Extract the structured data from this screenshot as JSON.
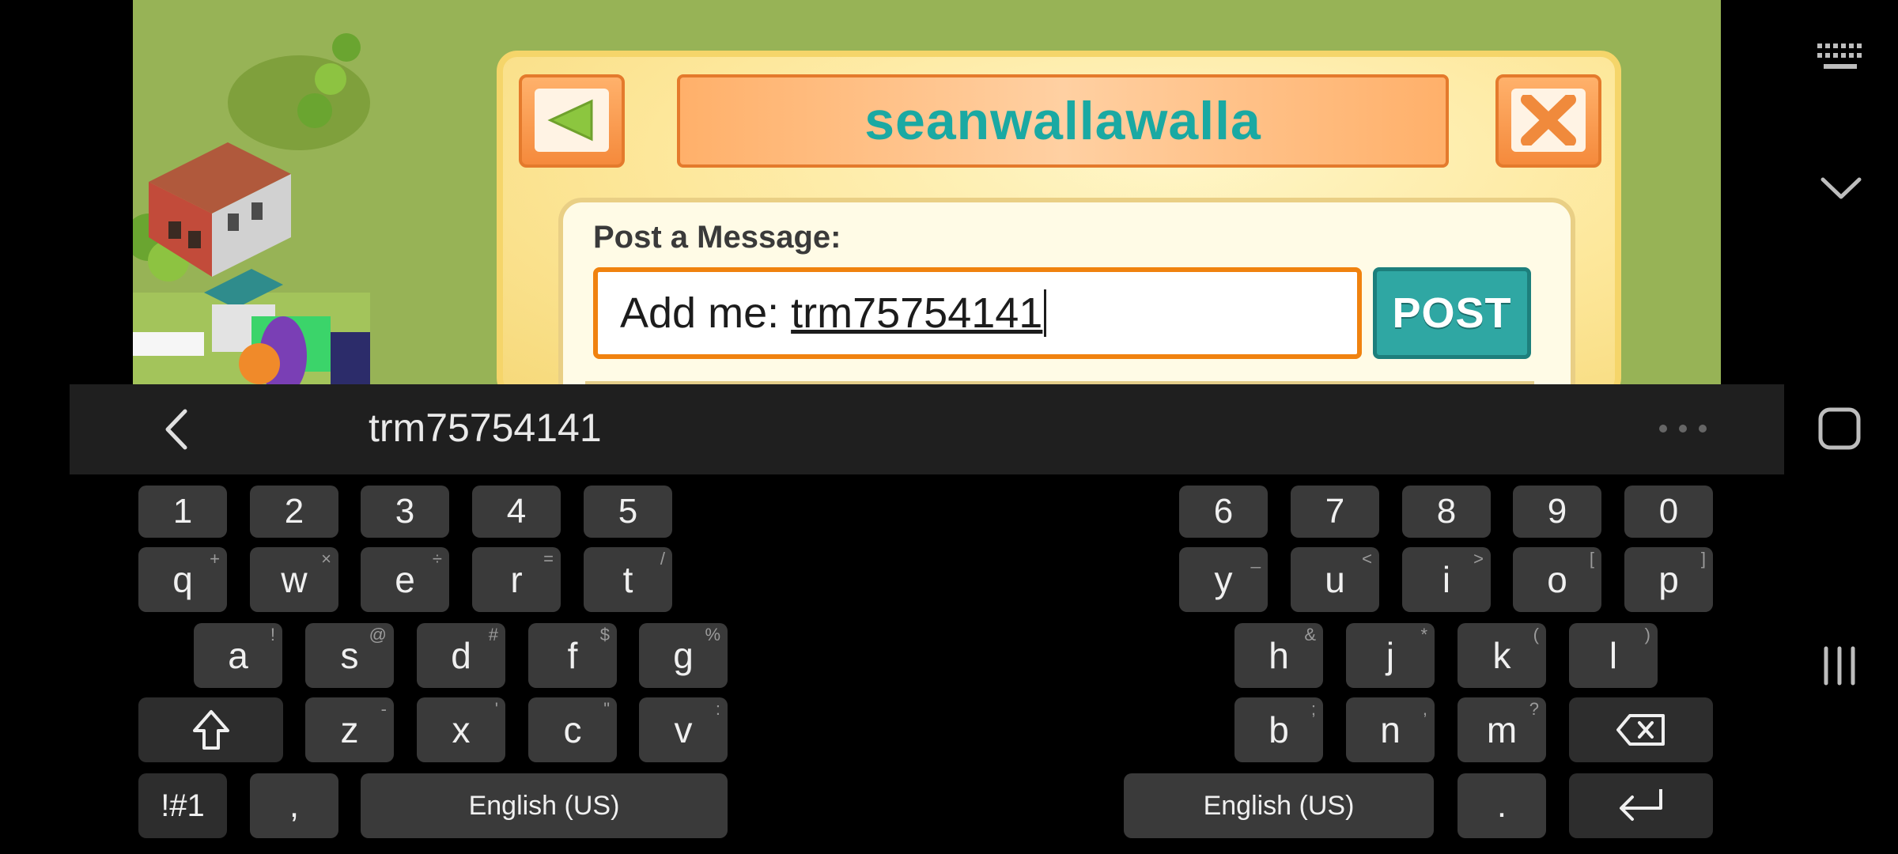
{
  "game": {
    "friend_name": "seanwallawalla",
    "post_label": "Post a Message:",
    "message_prefix": "Add me: ",
    "message_word": "trm75754141",
    "post_button": "POST"
  },
  "suggestion": {
    "text": "trm75754141"
  },
  "keyboard": {
    "left": {
      "numbers": [
        "1",
        "2",
        "3",
        "4",
        "5"
      ],
      "row1": [
        {
          "k": "q",
          "s": "+"
        },
        {
          "k": "w",
          "s": "×"
        },
        {
          "k": "e",
          "s": "÷"
        },
        {
          "k": "r",
          "s": "="
        },
        {
          "k": "t",
          "s": "/"
        }
      ],
      "row2": [
        {
          "k": "a",
          "s": "!"
        },
        {
          "k": "s",
          "s": "@"
        },
        {
          "k": "d",
          "s": "#"
        },
        {
          "k": "f",
          "s": "$"
        },
        {
          "k": "g",
          "s": "%"
        }
      ],
      "row3": [
        {
          "k": "z",
          "s": "-"
        },
        {
          "k": "x",
          "s": "'"
        },
        {
          "k": "c",
          "s": "\""
        },
        {
          "k": "v",
          "s": ":"
        }
      ],
      "symbols": "!#1",
      "comma": ",",
      "space": "English (US)"
    },
    "right": {
      "numbers": [
        "6",
        "7",
        "8",
        "9",
        "0"
      ],
      "row1": [
        {
          "k": "y",
          "s": "_"
        },
        {
          "k": "u",
          "s": "<"
        },
        {
          "k": "i",
          "s": ">"
        },
        {
          "k": "o",
          "s": "["
        },
        {
          "k": "p",
          "s": "]"
        }
      ],
      "row2": [
        {
          "k": "h",
          "s": "&"
        },
        {
          "k": "j",
          "s": "*"
        },
        {
          "k": "k",
          "s": "("
        },
        {
          "k": "l",
          "s": ")"
        }
      ],
      "row3": [
        {
          "k": "b",
          "s": ";"
        },
        {
          "k": "n",
          "s": ","
        },
        {
          "k": "m",
          "s": "?"
        }
      ],
      "space": "English (US)",
      "period": "."
    }
  },
  "icons": [
    "back-arrow-icon",
    "close-x-icon",
    "chevron-left-icon",
    "more-dots-icon",
    "shift-icon",
    "backspace-icon",
    "enter-icon",
    "keyboard-icon",
    "chevron-down-icon",
    "home-icon",
    "recents-icon"
  ],
  "colors": {
    "accent": "#1aa9a3",
    "input_border": "#f0820f",
    "field_bg": "#97b356"
  }
}
